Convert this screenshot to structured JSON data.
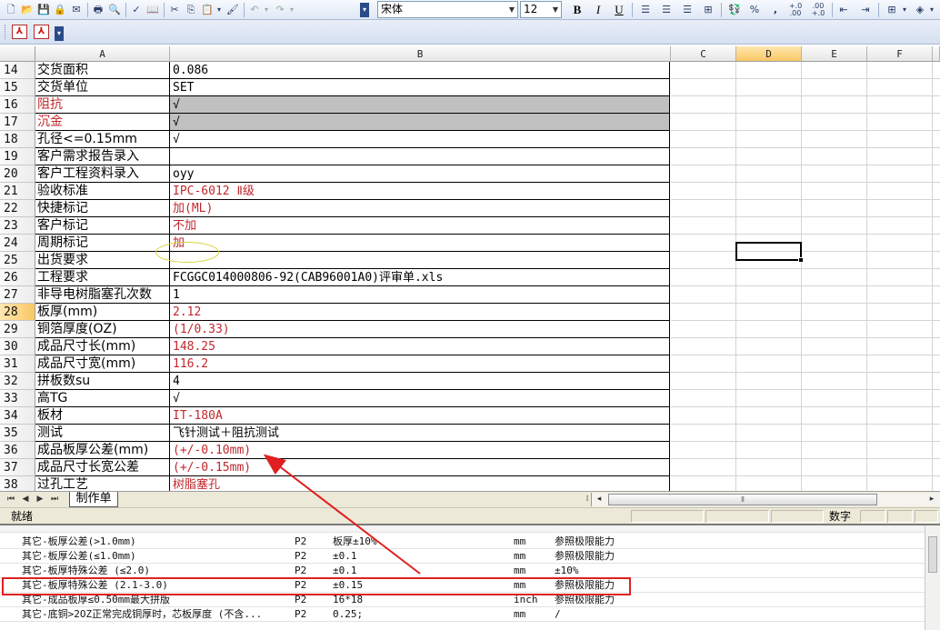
{
  "toolbar": {
    "font_name": "宋体",
    "font_size": "12",
    "bold_label": "B",
    "italic_label": "I",
    "underline_label": "U",
    "percent_label": "%",
    "comma_label": ",",
    "inc_decimal_label": "+.0\n.00",
    "dec_decimal_label": ".00\n+.0"
  },
  "columns": [
    "A",
    "B",
    "C",
    "D",
    "E",
    "F"
  ],
  "active_column": "D",
  "rows": [
    {
      "num": "14",
      "a": "交货面积",
      "b": "0.086",
      "a_red": false,
      "b_red": false,
      "gray": false
    },
    {
      "num": "15",
      "a": "交货单位",
      "b": "SET",
      "a_red": false,
      "b_red": false,
      "gray": false
    },
    {
      "num": "16",
      "a": "阻抗",
      "b": "√",
      "a_red": true,
      "b_red": false,
      "gray": true
    },
    {
      "num": "17",
      "a": "沉金",
      "b": "√",
      "a_red": true,
      "b_red": false,
      "gray": true
    },
    {
      "num": "18",
      "a": "孔径<=0.15mm",
      "b": "√",
      "a_red": false,
      "b_red": false,
      "gray": false
    },
    {
      "num": "19",
      "a": "客户需求报告录入",
      "b": "",
      "a_red": false,
      "b_red": false,
      "gray": false
    },
    {
      "num": "20",
      "a": "客户工程资料录入",
      "b": "oyy",
      "a_red": false,
      "b_red": false,
      "gray": false
    },
    {
      "num": "21",
      "a": "验收标准",
      "b": "IPC-6012 Ⅱ级",
      "a_red": false,
      "b_red": true,
      "gray": false
    },
    {
      "num": "22",
      "a": "快捷标记",
      "b": "加(ML)",
      "a_red": false,
      "b_red": true,
      "gray": false
    },
    {
      "num": "23",
      "a": "客户标记",
      "b": "不加",
      "a_red": false,
      "b_red": true,
      "gray": false
    },
    {
      "num": "24",
      "a": "周期标记",
      "b": "加",
      "a_red": false,
      "b_red": true,
      "gray": false
    },
    {
      "num": "25",
      "a": "出货要求",
      "b": "",
      "a_red": false,
      "b_red": false,
      "gray": false
    },
    {
      "num": "26",
      "a": "工程要求",
      "b": "FCGGC014000806-92(CAB96001A0)评审单.xls",
      "a_red": false,
      "b_red": false,
      "gray": false
    },
    {
      "num": "27",
      "a": "非导电树脂塞孔次数",
      "b": "1",
      "a_red": false,
      "b_red": false,
      "gray": false
    },
    {
      "num": "28",
      "a": "板厚(mm)",
      "b": "2.12",
      "a_red": false,
      "b_red": true,
      "gray": false
    },
    {
      "num": "29",
      "a": "铜箔厚度(OZ)",
      "b": "(1/0.33)",
      "a_red": false,
      "b_red": true,
      "gray": false
    },
    {
      "num": "30",
      "a": "成品尺寸长(mm)",
      "b": "148.25",
      "a_red": false,
      "b_red": true,
      "gray": false
    },
    {
      "num": "31",
      "a": "成品尺寸宽(mm)",
      "b": "116.2",
      "a_red": false,
      "b_red": true,
      "gray": false
    },
    {
      "num": "32",
      "a": "拼板数su",
      "b": "4",
      "a_red": false,
      "b_red": false,
      "gray": false
    },
    {
      "num": "33",
      "a": "高TG",
      "b": "√",
      "a_red": false,
      "b_red": false,
      "gray": false
    },
    {
      "num": "34",
      "a": "板材",
      "b": "IT-180A",
      "a_red": false,
      "b_red": true,
      "gray": false
    },
    {
      "num": "35",
      "a": "测试",
      "b": "飞针测试＋阻抗测试",
      "a_red": false,
      "b_red": false,
      "gray": false
    },
    {
      "num": "36",
      "a": "成品板厚公差(mm)",
      "b": "(+/-0.10mm)",
      "a_red": false,
      "b_red": true,
      "gray": false
    },
    {
      "num": "37",
      "a": "成品尺寸长宽公差",
      "b": "(+/-0.15mm)",
      "a_red": false,
      "b_red": true,
      "gray": false
    },
    {
      "num": "38",
      "a": "过孔工艺",
      "b": "树脂塞孔",
      "a_red": false,
      "b_red": true,
      "gray": false
    }
  ],
  "active_row": "28",
  "sheet_tab": "制作单",
  "status": {
    "ready": "就绪",
    "num_mode": "数字"
  },
  "lower_table": {
    "rows": [
      {
        "name": "其它-板厚公差(>1.0mm)",
        "level": "P2",
        "value": "板厚±10%",
        "unit": "mm",
        "ability": "参照极限能力"
      },
      {
        "name": "其它-板厚公差(≤1.0mm)",
        "level": "P2",
        "value": "±0.1",
        "unit": "mm",
        "ability": "参照极限能力"
      },
      {
        "name": "其它-板厚特殊公差 (≤2.0)",
        "level": "P2",
        "value": "±0.1",
        "unit": "mm",
        "ability": "±10%"
      },
      {
        "name": "其它-板厚特殊公差 (2.1-3.0)",
        "level": "P2",
        "value": "±0.15",
        "unit": "mm",
        "ability": "参照极限能力"
      },
      {
        "name": "其它-成品板厚≤0.50mm最大拼版",
        "level": "P2",
        "value": "16*18",
        "unit": "inch",
        "ability": "参照极限能力"
      },
      {
        "name": "其它-底铜>2OZ正常完成铜厚时，芯板厚度 (不含...",
        "level": "P2",
        "value": "0.25;",
        "unit": "mm",
        "ability": "/"
      }
    ]
  },
  "colors": {
    "red_text": "#c0282d",
    "highlight_box": "#e02020",
    "ellipse": "#d8d23a",
    "gray_fill": "#c0c0c0"
  }
}
